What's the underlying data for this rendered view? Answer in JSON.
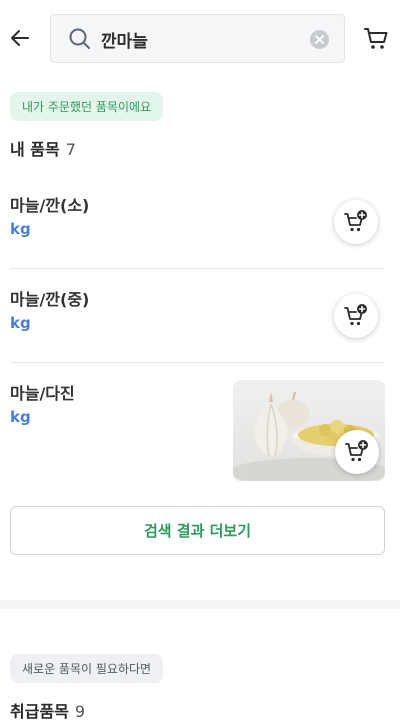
{
  "header": {
    "search_value": "깐마늘",
    "icons": [
      "back-arrow-icon",
      "search-icon",
      "clear-icon",
      "cart-icon"
    ]
  },
  "my_items": {
    "badge": "내가 주문했던 품목이에요",
    "title": "내 품목",
    "count": "7",
    "items": [
      {
        "name": "마늘/깐(소)",
        "unit": "kg"
      },
      {
        "name": "마늘/깐(중)",
        "unit": "kg"
      },
      {
        "name": "마늘/다진",
        "unit": "kg"
      }
    ],
    "more_button": "검색 결과 더보기"
  },
  "handled_items": {
    "badge": "새로운 품목이 필요하다면",
    "title": "취급품목",
    "count": "9"
  },
  "colors": {
    "accent_green": "#2e9a5c",
    "unit_blue": "#4a7fd6",
    "badge_green_bg": "#e4f5ec"
  }
}
